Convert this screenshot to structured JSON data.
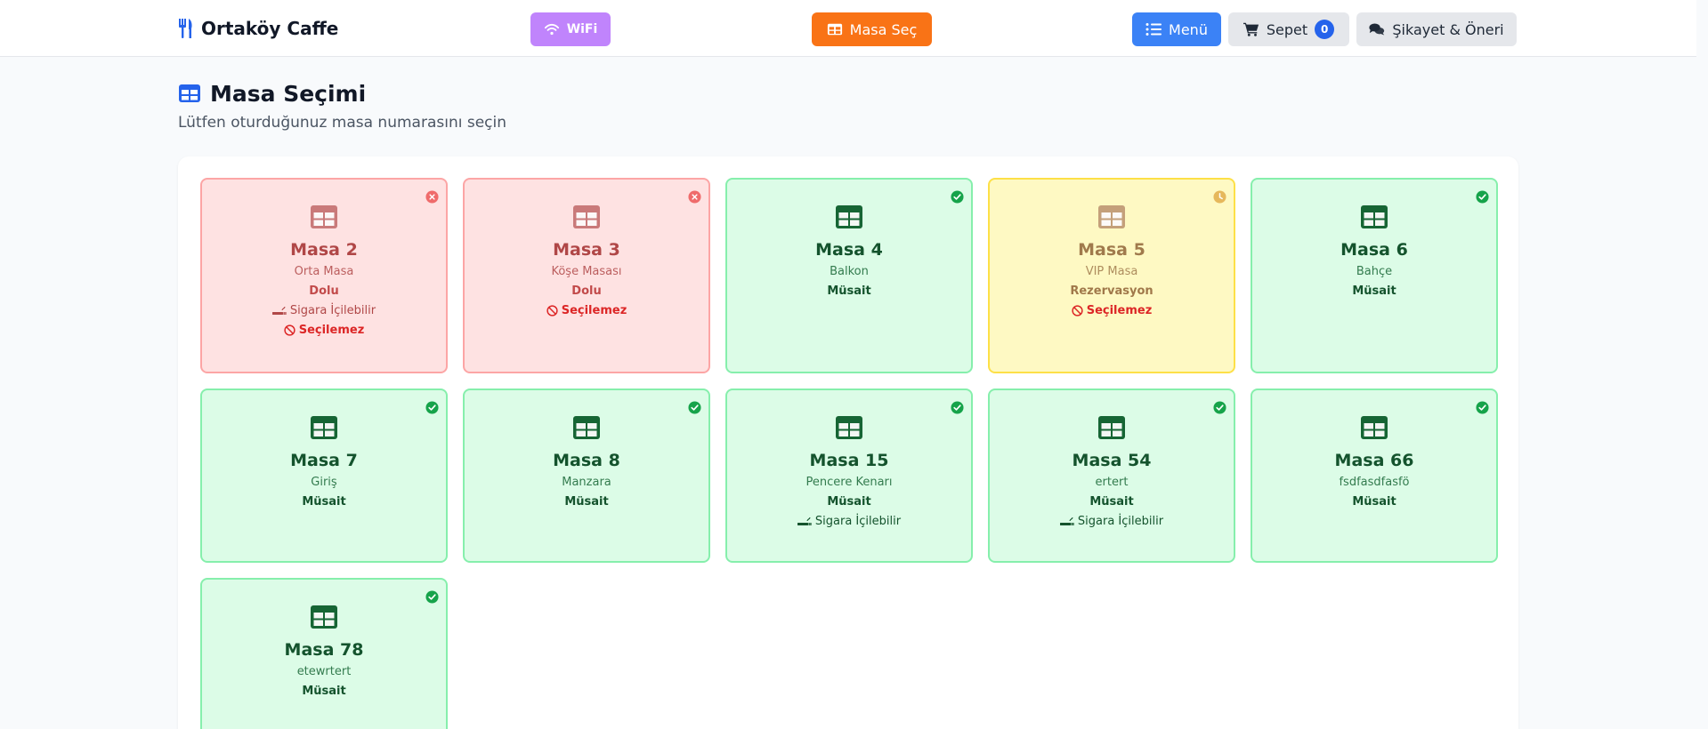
{
  "nav": {
    "brand": "Ortaköy Caffe",
    "wifi": "WiFi",
    "masa_sec": "Masa Seç",
    "menu": "Menü",
    "sepet": "Sepet",
    "sepet_count": "0",
    "sikayet": "Şikayet & Öneri"
  },
  "page": {
    "title": "Masa Seçimi",
    "subtitle": "Lütfen oturduğunuz masa numarasını seçin"
  },
  "colors": {
    "brand_icon": "#2563eb",
    "dolu_icon": "#c97a7a",
    "musait_icon": "#166534",
    "rez_icon": "#c4a07a",
    "check": "#16a34a",
    "x": "#ef6b6b",
    "clock": "#e6b85c"
  },
  "tables": [
    {
      "name": "Masa 2",
      "location": "Orta Masa",
      "status": "Dolu",
      "kind": "dolu",
      "smoking": "Sigara İçilebilir",
      "selectable": "Seçilemez"
    },
    {
      "name": "Masa 3",
      "location": "Köşe Masası",
      "status": "Dolu",
      "kind": "dolu",
      "smoking": "",
      "selectable": "Seçilemez"
    },
    {
      "name": "Masa 4",
      "location": "Balkon",
      "status": "Müsait",
      "kind": "musait",
      "smoking": "",
      "selectable": ""
    },
    {
      "name": "Masa 5",
      "location": "VIP Masa",
      "status": "Rezervasyon",
      "kind": "rez",
      "smoking": "",
      "selectable": "Seçilemez"
    },
    {
      "name": "Masa 6",
      "location": "Bahçe",
      "status": "Müsait",
      "kind": "musait",
      "smoking": "",
      "selectable": ""
    },
    {
      "name": "Masa 7",
      "location": "Giriş",
      "status": "Müsait",
      "kind": "musait",
      "smoking": "",
      "selectable": ""
    },
    {
      "name": "Masa 8",
      "location": "Manzara",
      "status": "Müsait",
      "kind": "musait",
      "smoking": "",
      "selectable": ""
    },
    {
      "name": "Masa 15",
      "location": "Pencere Kenarı",
      "status": "Müsait",
      "kind": "musait",
      "smoking": "Sigara İçilebilir",
      "selectable": ""
    },
    {
      "name": "Masa 54",
      "location": "ertert",
      "status": "Müsait",
      "kind": "musait",
      "smoking": "Sigara İçilebilir",
      "selectable": ""
    },
    {
      "name": "Masa 66",
      "location": "fsdfasdfasfö",
      "status": "Müsait",
      "kind": "musait",
      "smoking": "",
      "selectable": ""
    },
    {
      "name": "Masa 78",
      "location": "etewrtert",
      "status": "Müsait",
      "kind": "musait",
      "smoking": "",
      "selectable": ""
    }
  ]
}
